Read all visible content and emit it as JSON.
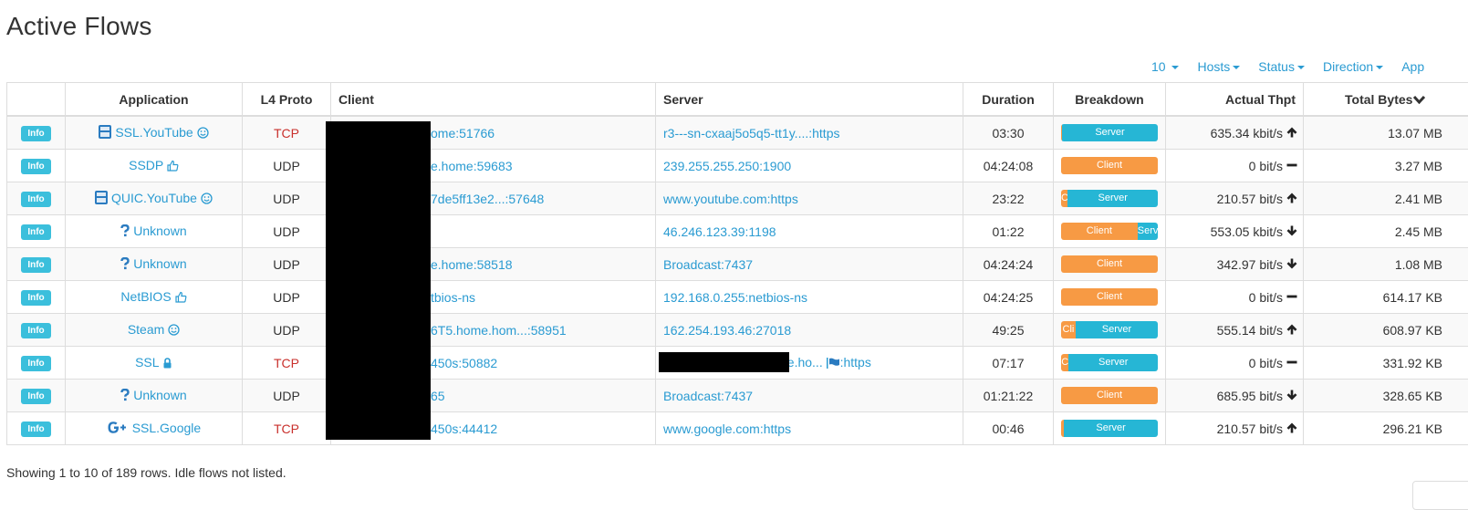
{
  "page": {
    "title": "Active Flows"
  },
  "toolbar": [
    {
      "label": "10"
    },
    {
      "label": "Hosts"
    },
    {
      "label": "Status"
    },
    {
      "label": "Direction"
    },
    {
      "label": "App"
    }
  ],
  "table": {
    "columns": [
      "",
      "Application",
      "L4 Proto",
      "Client",
      "Server",
      "Duration",
      "Breakdown",
      "Actual Thpt",
      "Total Bytes"
    ],
    "sort_icon": "chevron-down-icon",
    "info_label": "Info",
    "rows": [
      {
        "app": "SSL.YouTube",
        "app_icon": "youtube-icon",
        "app_suffix_icon": "smile-icon",
        "proto": "TCP",
        "client": "ome:51766",
        "server": "r3---sn-cxaaj5o5q5-tt1y....:https",
        "duration": "03:30",
        "client_pct": 1,
        "client_label": "",
        "server_label": "Server",
        "thpt": "635.34 kbit/s",
        "trend": "up",
        "bytes": "13.07 MB"
      },
      {
        "app": "SSDP",
        "app_icon": "",
        "app_suffix_icon": "thumbs-up-icon",
        "proto": "UDP",
        "client": "e.home:59683",
        "server": "239.255.255.250:1900",
        "duration": "04:24:08",
        "client_pct": 100,
        "client_label": "Client",
        "server_label": "",
        "thpt": "0 bit/s",
        "trend": "flat",
        "bytes": "3.27 MB"
      },
      {
        "app": "QUIC.YouTube",
        "app_icon": "youtube-icon",
        "app_suffix_icon": "smile-icon",
        "proto": "UDP",
        "client": "7de5ff13e2...:57648",
        "server": "www.youtube.com:https",
        "duration": "23:22",
        "client_pct": 7,
        "client_label": "C",
        "server_label": "Server",
        "thpt": "210.57 bit/s",
        "trend": "up",
        "bytes": "2.41 MB"
      },
      {
        "app": "Unknown",
        "app_icon": "question-icon",
        "app_suffix_icon": "",
        "proto": "UDP",
        "client": "",
        "server": "46.246.123.39:1198",
        "duration": "01:22",
        "client_pct": 79,
        "client_label": "Client",
        "server_label": "Serv",
        "thpt": "553.05 kbit/s",
        "trend": "down",
        "bytes": "2.45 MB"
      },
      {
        "app": "Unknown",
        "app_icon": "question-icon",
        "app_suffix_icon": "",
        "proto": "UDP",
        "client": "e.home:58518",
        "server": "Broadcast:7437",
        "duration": "04:24:24",
        "client_pct": 100,
        "client_label": "Client",
        "server_label": "",
        "thpt": "342.97 bit/s",
        "trend": "down",
        "bytes": "1.08 MB"
      },
      {
        "app": "NetBIOS",
        "app_icon": "",
        "app_suffix_icon": "thumbs-up-icon",
        "proto": "UDP",
        "client": "tbios-ns",
        "server": "192.168.0.255:netbios-ns",
        "duration": "04:24:25",
        "client_pct": 100,
        "client_label": "Client",
        "server_label": "",
        "thpt": "0 bit/s",
        "trend": "flat",
        "bytes": "614.17 KB"
      },
      {
        "app": "Steam",
        "app_icon": "",
        "app_suffix_icon": "smile-icon",
        "proto": "UDP",
        "client": "6T5.home.hom...:58951",
        "server": "162.254.193.46:27018",
        "duration": "49:25",
        "client_pct": 15,
        "client_label": "Cli",
        "server_label": "Server",
        "thpt": "555.14 bit/s",
        "trend": "up",
        "bytes": "608.97 KB"
      },
      {
        "app": "SSL",
        "app_icon": "",
        "app_suffix_icon": "lock-icon",
        "proto": "TCP",
        "client": "450s:50882",
        "server": "ne.ho...",
        "server_suffix": ":https",
        "server_flag": true,
        "duration": "07:17",
        "client_pct": 8,
        "client_label": "C",
        "server_label": "Server",
        "thpt": "0 bit/s",
        "trend": "flat",
        "bytes": "331.92 KB"
      },
      {
        "app": "Unknown",
        "app_icon": "question-icon",
        "app_suffix_icon": "",
        "proto": "UDP",
        "client": "65",
        "server": "Broadcast:7437",
        "duration": "01:21:22",
        "client_pct": 100,
        "client_label": "Client",
        "server_label": "",
        "thpt": "685.95 bit/s",
        "trend": "down",
        "bytes": "328.65 KB"
      },
      {
        "app": "SSL.Google",
        "app_icon": "google-plus-icon",
        "app_suffix_icon": "",
        "proto": "TCP",
        "client": "450s:44412",
        "server": "www.google.com:https",
        "duration": "00:46",
        "client_pct": 3,
        "client_label": "",
        "server_label": "Server",
        "thpt": "210.57 bit/s",
        "trend": "up",
        "bytes": "296.21 KB"
      }
    ]
  },
  "colors": {
    "link": "#2a9bd2",
    "tcp": "#c9302c",
    "client_bar": "#f79a44",
    "server_bar": "#26b6d5",
    "info_badge": "#3bbfdc"
  },
  "footer": {
    "text": "Showing 1 to 10 of 189 rows. Idle flows not listed."
  }
}
